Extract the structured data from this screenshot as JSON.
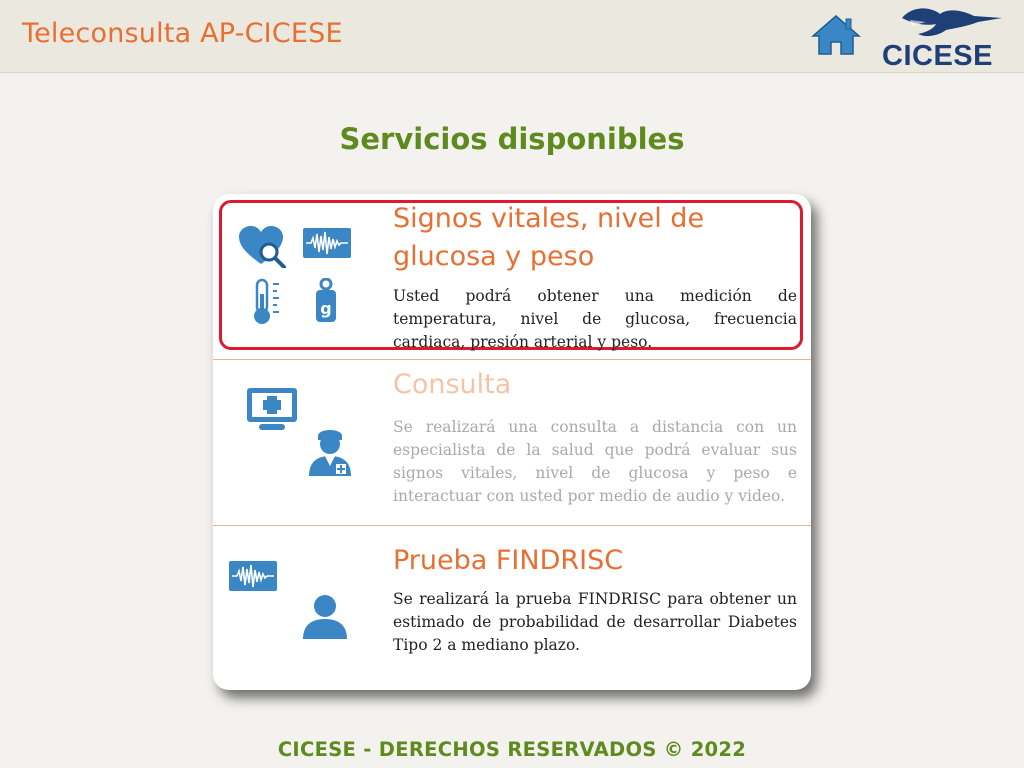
{
  "header": {
    "app_title": "Teleconsulta AP-CICESE",
    "logo_text": "CICESE"
  },
  "main": {
    "title": "Servicios disponibles",
    "services": [
      {
        "title_line1": "Signos vitales, nivel de",
        "title_line2": "glucosa y peso",
        "description": "Usted podrá obtener una medición de temperatura, nivel de glucosa, frecuencia cardiaca, presión arterial y peso.",
        "selected": true
      },
      {
        "title": "Consulta",
        "description": "Se realizará una consulta a distancia con un especialista de la salud que podrá evaluar sus signos vitales, nivel de glucosa y peso e interactuar con usted por medio de audio y video.",
        "enabled": false
      },
      {
        "title": "Prueba FINDRISC",
        "description": "Se realizará la prueba FINDRISC para obtener un estimado de probabilidad de desarrollar Diabetes Tipo 2 a mediano plazo.",
        "enabled": true
      }
    ]
  },
  "footer": {
    "text": "CICESE - DERECHOS RESERVADOS © 2022"
  },
  "colors": {
    "accent_orange": "#e86f32",
    "title_green": "#5e8a1e",
    "icon_blue": "#3b87c6",
    "highlight_red": "#dd1a2e"
  },
  "icons": [
    "home-icon",
    "heart-search-icon",
    "ecg-waveform-icon",
    "thermometer-icon",
    "weight-icon",
    "medical-monitor-icon",
    "doctor-icon",
    "user-icon"
  ]
}
